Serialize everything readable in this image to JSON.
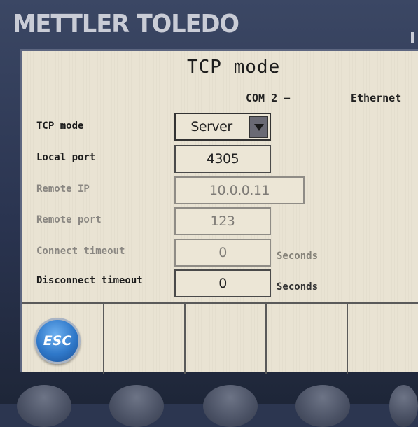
{
  "brand": {
    "name": "METTLER TOLEDO"
  },
  "header": {
    "title": "TCP mode",
    "com_port": "COM 2 –",
    "interface": "Ethernet"
  },
  "form": {
    "tcp_mode": {
      "label": "TCP mode",
      "value": "Server"
    },
    "local_port": {
      "label": "Local port",
      "value": "4305"
    },
    "remote_ip": {
      "label": "Remote IP",
      "value": "10.0.0.11"
    },
    "remote_port": {
      "label": "Remote port",
      "value": "123"
    },
    "connect_timeout": {
      "label": "Connect timeout",
      "value": "0",
      "unit": "Seconds"
    },
    "disconnect_timeout": {
      "label": "Disconnect timeout",
      "value": "0",
      "unit": "Seconds"
    }
  },
  "softkeys": {
    "esc_label": "ESC"
  },
  "colors": {
    "screen_bg": "#e9e3d3",
    "bezel": "#2c3650",
    "esc_blue": "#2f78c9"
  }
}
